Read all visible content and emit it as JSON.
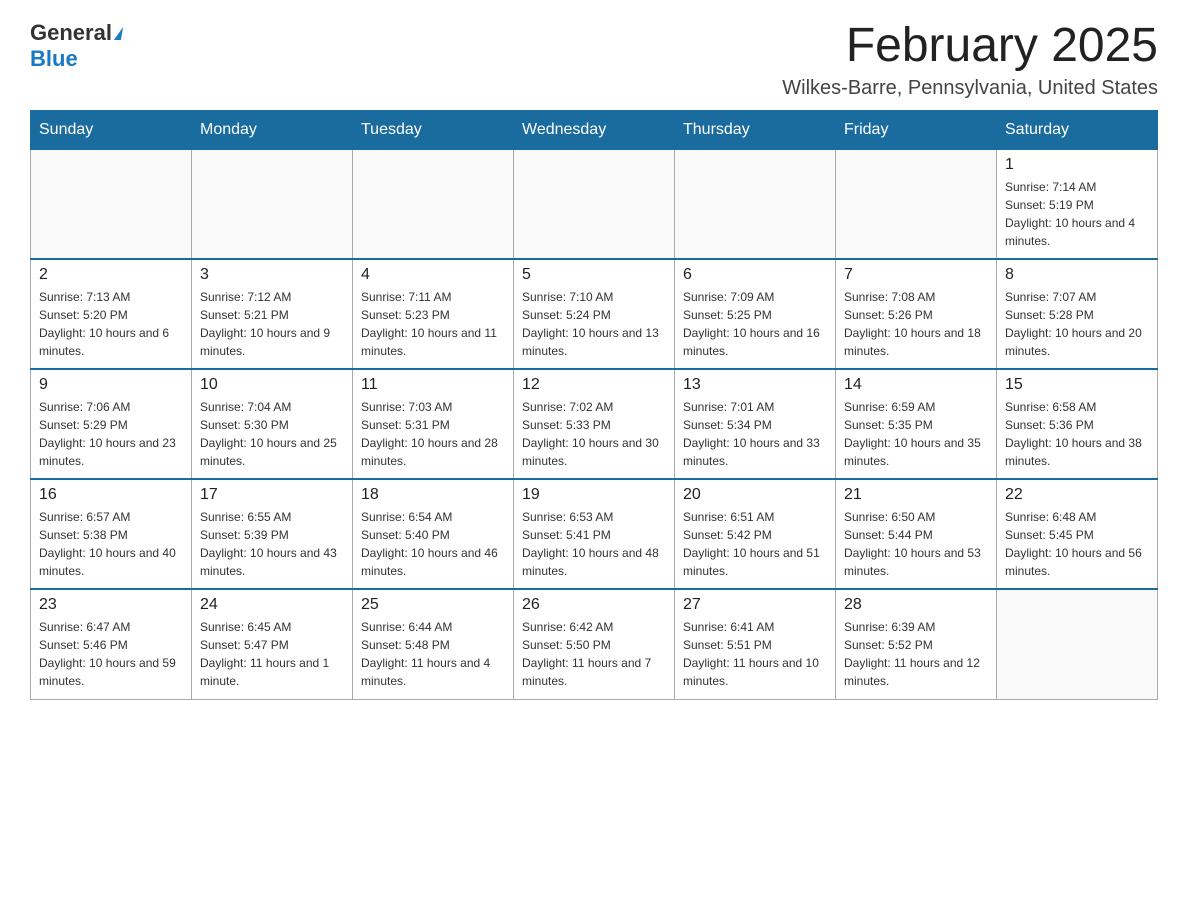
{
  "header": {
    "logo_general": "General",
    "logo_blue": "Blue",
    "month_title": "February 2025",
    "location": "Wilkes-Barre, Pennsylvania, United States"
  },
  "weekdays": [
    "Sunday",
    "Monday",
    "Tuesday",
    "Wednesday",
    "Thursday",
    "Friday",
    "Saturday"
  ],
  "weeks": [
    [
      {
        "day": "",
        "info": ""
      },
      {
        "day": "",
        "info": ""
      },
      {
        "day": "",
        "info": ""
      },
      {
        "day": "",
        "info": ""
      },
      {
        "day": "",
        "info": ""
      },
      {
        "day": "",
        "info": ""
      },
      {
        "day": "1",
        "info": "Sunrise: 7:14 AM\nSunset: 5:19 PM\nDaylight: 10 hours and 4 minutes."
      }
    ],
    [
      {
        "day": "2",
        "info": "Sunrise: 7:13 AM\nSunset: 5:20 PM\nDaylight: 10 hours and 6 minutes."
      },
      {
        "day": "3",
        "info": "Sunrise: 7:12 AM\nSunset: 5:21 PM\nDaylight: 10 hours and 9 minutes."
      },
      {
        "day": "4",
        "info": "Sunrise: 7:11 AM\nSunset: 5:23 PM\nDaylight: 10 hours and 11 minutes."
      },
      {
        "day": "5",
        "info": "Sunrise: 7:10 AM\nSunset: 5:24 PM\nDaylight: 10 hours and 13 minutes."
      },
      {
        "day": "6",
        "info": "Sunrise: 7:09 AM\nSunset: 5:25 PM\nDaylight: 10 hours and 16 minutes."
      },
      {
        "day": "7",
        "info": "Sunrise: 7:08 AM\nSunset: 5:26 PM\nDaylight: 10 hours and 18 minutes."
      },
      {
        "day": "8",
        "info": "Sunrise: 7:07 AM\nSunset: 5:28 PM\nDaylight: 10 hours and 20 minutes."
      }
    ],
    [
      {
        "day": "9",
        "info": "Sunrise: 7:06 AM\nSunset: 5:29 PM\nDaylight: 10 hours and 23 minutes."
      },
      {
        "day": "10",
        "info": "Sunrise: 7:04 AM\nSunset: 5:30 PM\nDaylight: 10 hours and 25 minutes."
      },
      {
        "day": "11",
        "info": "Sunrise: 7:03 AM\nSunset: 5:31 PM\nDaylight: 10 hours and 28 minutes."
      },
      {
        "day": "12",
        "info": "Sunrise: 7:02 AM\nSunset: 5:33 PM\nDaylight: 10 hours and 30 minutes."
      },
      {
        "day": "13",
        "info": "Sunrise: 7:01 AM\nSunset: 5:34 PM\nDaylight: 10 hours and 33 minutes."
      },
      {
        "day": "14",
        "info": "Sunrise: 6:59 AM\nSunset: 5:35 PM\nDaylight: 10 hours and 35 minutes."
      },
      {
        "day": "15",
        "info": "Sunrise: 6:58 AM\nSunset: 5:36 PM\nDaylight: 10 hours and 38 minutes."
      }
    ],
    [
      {
        "day": "16",
        "info": "Sunrise: 6:57 AM\nSunset: 5:38 PM\nDaylight: 10 hours and 40 minutes."
      },
      {
        "day": "17",
        "info": "Sunrise: 6:55 AM\nSunset: 5:39 PM\nDaylight: 10 hours and 43 minutes."
      },
      {
        "day": "18",
        "info": "Sunrise: 6:54 AM\nSunset: 5:40 PM\nDaylight: 10 hours and 46 minutes."
      },
      {
        "day": "19",
        "info": "Sunrise: 6:53 AM\nSunset: 5:41 PM\nDaylight: 10 hours and 48 minutes."
      },
      {
        "day": "20",
        "info": "Sunrise: 6:51 AM\nSunset: 5:42 PM\nDaylight: 10 hours and 51 minutes."
      },
      {
        "day": "21",
        "info": "Sunrise: 6:50 AM\nSunset: 5:44 PM\nDaylight: 10 hours and 53 minutes."
      },
      {
        "day": "22",
        "info": "Sunrise: 6:48 AM\nSunset: 5:45 PM\nDaylight: 10 hours and 56 minutes."
      }
    ],
    [
      {
        "day": "23",
        "info": "Sunrise: 6:47 AM\nSunset: 5:46 PM\nDaylight: 10 hours and 59 minutes."
      },
      {
        "day": "24",
        "info": "Sunrise: 6:45 AM\nSunset: 5:47 PM\nDaylight: 11 hours and 1 minute."
      },
      {
        "day": "25",
        "info": "Sunrise: 6:44 AM\nSunset: 5:48 PM\nDaylight: 11 hours and 4 minutes."
      },
      {
        "day": "26",
        "info": "Sunrise: 6:42 AM\nSunset: 5:50 PM\nDaylight: 11 hours and 7 minutes."
      },
      {
        "day": "27",
        "info": "Sunrise: 6:41 AM\nSunset: 5:51 PM\nDaylight: 11 hours and 10 minutes."
      },
      {
        "day": "28",
        "info": "Sunrise: 6:39 AM\nSunset: 5:52 PM\nDaylight: 11 hours and 12 minutes."
      },
      {
        "day": "",
        "info": ""
      }
    ]
  ]
}
